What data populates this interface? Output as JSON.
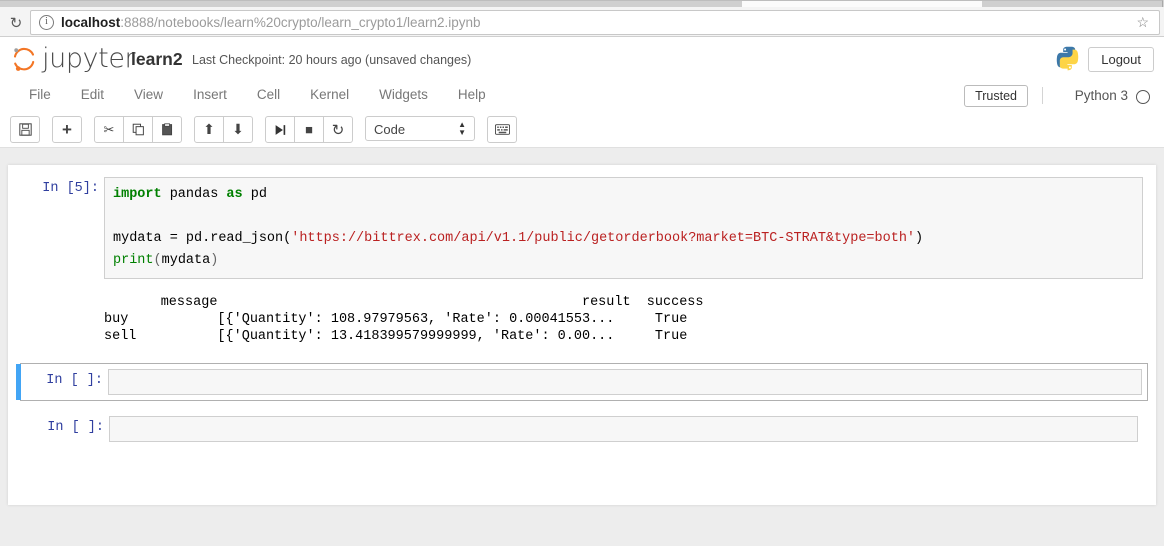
{
  "browser": {
    "reload_icon": "reload-icon",
    "info_icon": "info-icon",
    "star_icon": "bookmark-star-icon",
    "url_host": "localhost",
    "url_path": ":8888/notebooks/learn%20crypto/learn_crypto1/learn2.ipynb"
  },
  "header": {
    "logo_text": "jupyter",
    "notebook_name": "learn2",
    "checkpoint": "Last Checkpoint: 20 hours ago (unsaved changes)",
    "logout_label": "Logout",
    "python_logo_icon": "python-logo-icon"
  },
  "menubar": {
    "items": [
      {
        "label": "File"
      },
      {
        "label": "Edit"
      },
      {
        "label": "View"
      },
      {
        "label": "Insert"
      },
      {
        "label": "Cell"
      },
      {
        "label": "Kernel"
      },
      {
        "label": "Widgets"
      },
      {
        "label": "Help"
      }
    ],
    "trusted_label": "Trusted",
    "kernel_name": "Python 3",
    "kernel_indicator_icon": "kernel-idle-circle-icon"
  },
  "toolbar": {
    "buttons": [
      {
        "name": "save-button",
        "icon": "floppy-disk-icon",
        "glyph": "ὋE"
      },
      {
        "name": "insert-cell-button",
        "icon": "plus-icon",
        "glyph": "+"
      },
      {
        "name": "cut-cell-button",
        "icon": "scissors-icon",
        "glyph": "✂"
      },
      {
        "name": "copy-cell-button",
        "icon": "copy-icon",
        "glyph": "❐"
      },
      {
        "name": "paste-cell-button",
        "icon": "paste-icon",
        "glyph": "ὌB"
      },
      {
        "name": "move-cell-up-button",
        "icon": "arrow-up-icon",
        "glyph": "↑"
      },
      {
        "name": "move-cell-down-button",
        "icon": "arrow-down-icon",
        "glyph": "↓"
      },
      {
        "name": "run-cell-button",
        "icon": "play-to-next-icon",
        "glyph": "▶|"
      },
      {
        "name": "interrupt-kernel-button",
        "icon": "stop-square-icon",
        "glyph": "■"
      },
      {
        "name": "restart-kernel-button",
        "icon": "restart-circle-arrow-icon",
        "glyph": "↻"
      }
    ],
    "cell_type_value": "Code",
    "command_palette_icon": "keyboard-icon"
  },
  "notebook": {
    "cells": [
      {
        "prompt": "In [5]:",
        "selected": false,
        "lines": [
          [
            {
              "t": "import",
              "c": "kw"
            },
            {
              "t": " pandas ",
              "c": ""
            },
            {
              "t": "as",
              "c": "kw"
            },
            {
              "t": " pd",
              "c": ""
            }
          ],
          [],
          [
            {
              "t": "mydata = pd.read_json(",
              "c": ""
            },
            {
              "t": "'https://bittrex.com/api/v1.1/public/getorderbook?market=BTC-STRAT&type=both'",
              "c": "str"
            },
            {
              "t": ")",
              "c": ""
            }
          ],
          [
            {
              "t": "print",
              "c": "bi"
            },
            {
              "t": "(mydata)",
              "c": "op"
            }
          ]
        ],
        "output": [
          "       message                                             result  success",
          "buy           [{'Quantity': 108.97979563, 'Rate': 0.00041553...     True",
          "sell          [{'Quantity': 13.418399579999999, 'Rate': 0.00...     True"
        ]
      },
      {
        "prompt": "In [ ]:",
        "selected": true,
        "lines": [],
        "output": []
      },
      {
        "prompt": "In [ ]:",
        "selected": false,
        "lines": [],
        "output": []
      }
    ]
  },
  "colors": {
    "accent_blue": "#42a5f5",
    "prompt_blue": "#303f9f",
    "string_red": "#ba2121",
    "keyword_green": "#008000",
    "jupyter_orange": "#f37626",
    "cell_bg": "#f7f7f7"
  }
}
